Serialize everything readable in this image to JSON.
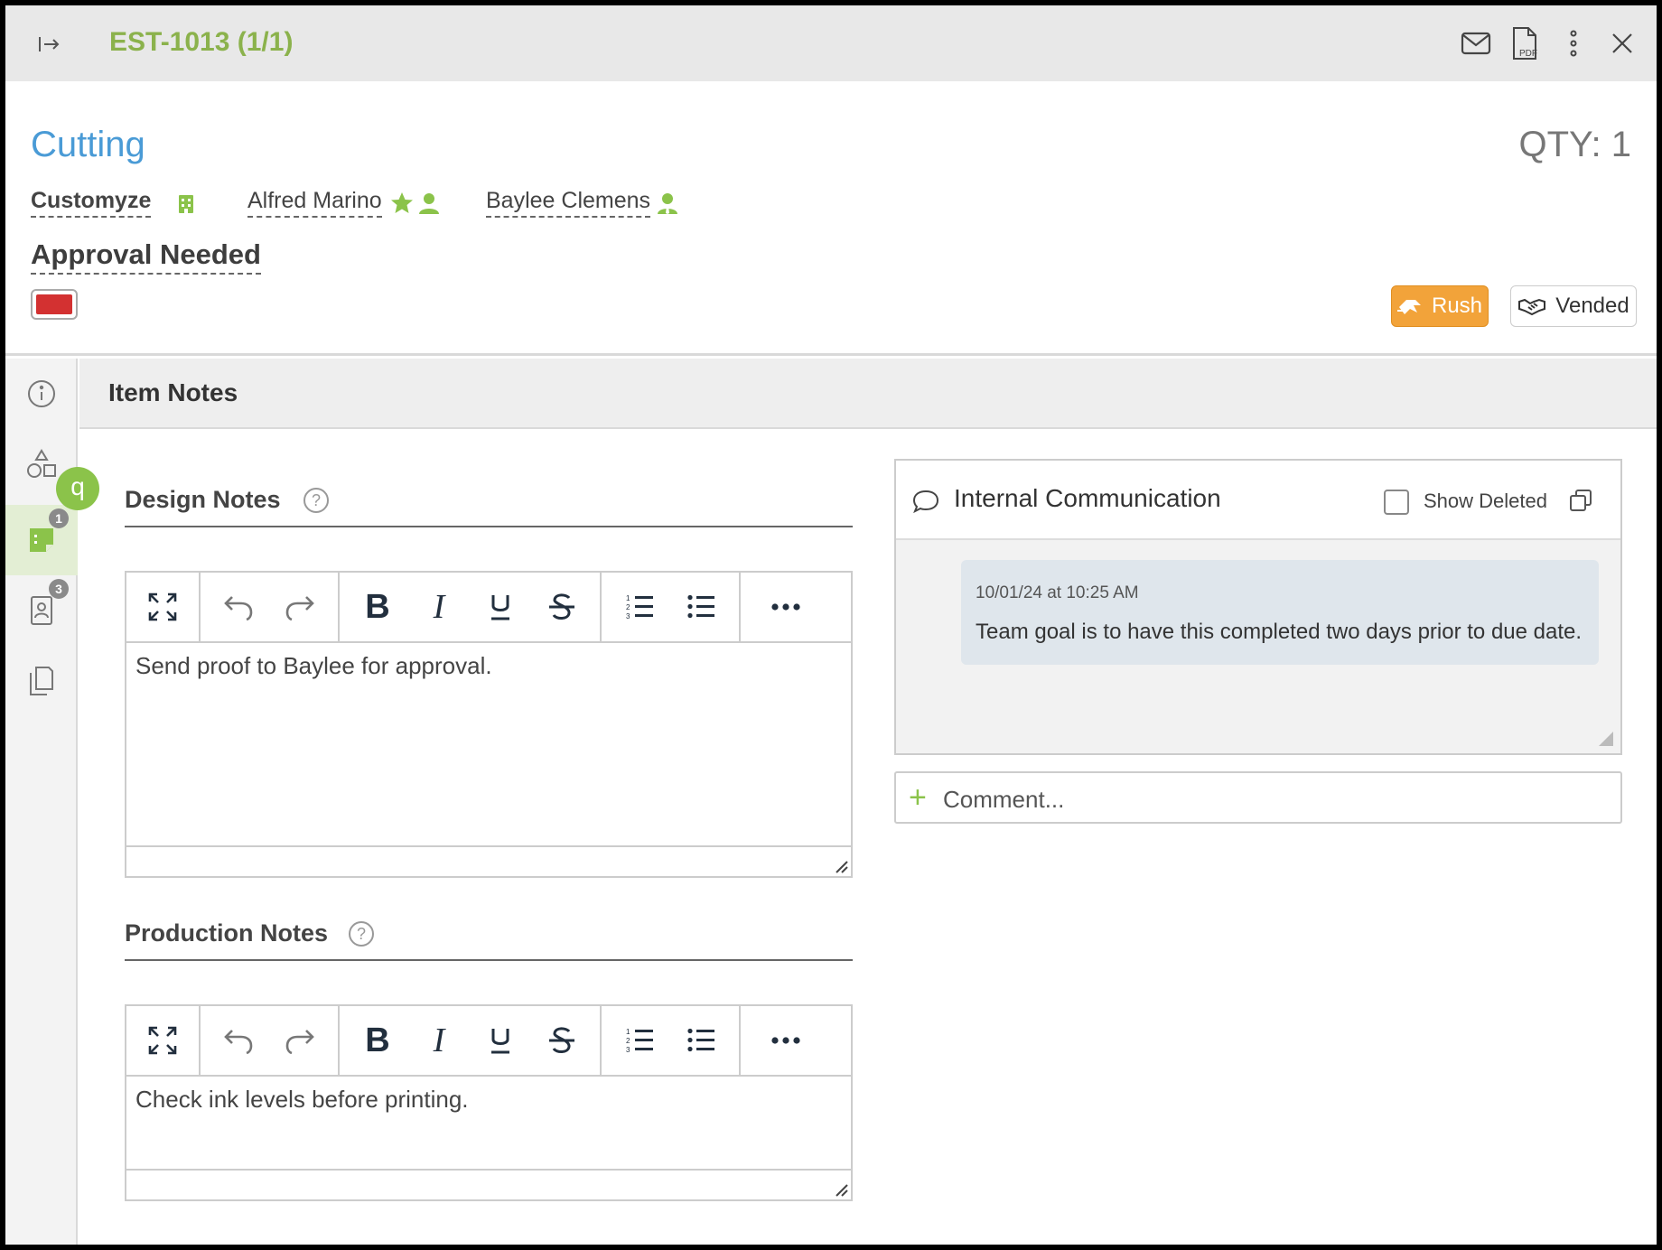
{
  "titlebar": {
    "estimate_id": "EST-1013 (1/1)",
    "icons": [
      "collapse-icon",
      "mail-icon",
      "pdf-icon",
      "more-vertical-icon",
      "close-icon"
    ],
    "pdf_label": "PDF"
  },
  "header": {
    "item_title": "Cutting",
    "qty": "QTY: 1",
    "company": "Customyze",
    "contact_primary": "Alfred Marino",
    "contact_secondary": "Baylee Clemens",
    "status": "Approval Needed",
    "swatch_color": "#d33131",
    "rush_label": "Rush",
    "vended_label": "Vended"
  },
  "rail": {
    "items": [
      {
        "icon": "info-icon"
      },
      {
        "icon": "shapes-icon"
      },
      {
        "icon": "sticky-note-icon",
        "badge": "1",
        "active": true
      },
      {
        "icon": "contact-card-icon",
        "badge": "3"
      },
      {
        "icon": "documents-icon"
      }
    ],
    "avatar_letter": "q"
  },
  "section": {
    "title": "Item Notes"
  },
  "design_notes": {
    "label": "Design Notes",
    "help": "?",
    "content": "Send proof to Baylee for approval."
  },
  "production_notes": {
    "label": "Production Notes",
    "help": "?",
    "content": "Check ink levels before printing."
  },
  "communication": {
    "title": "Internal Communication",
    "show_deleted_label": "Show Deleted",
    "messages": [
      {
        "timestamp": "10/01/24 at 10:25 AM",
        "text": "Team goal is to have this completed two days prior to due date."
      }
    ],
    "comment_placeholder": "Comment..."
  },
  "colors": {
    "accent_green": "#8bb24c",
    "link_blue": "#4a9bd6",
    "rush_orange": "#f2a33a"
  }
}
